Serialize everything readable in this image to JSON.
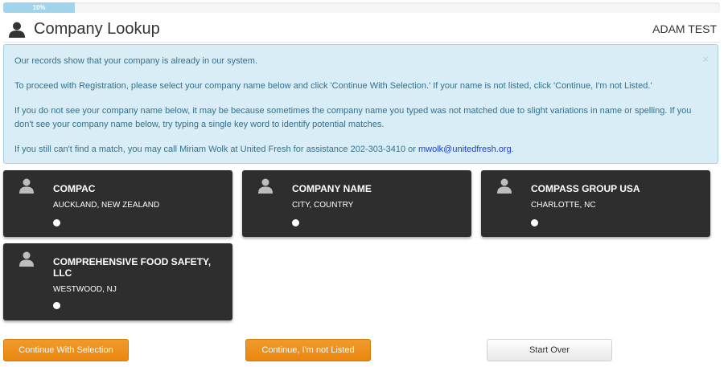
{
  "progress": {
    "value": 0.1,
    "label": "10%"
  },
  "header": {
    "title": "Company Lookup",
    "user": "ADAM TEST",
    "icon": "user-icon"
  },
  "alert": {
    "line1": "Our records show that your company is already in our system.",
    "line2": "To proceed with Registration, please select your company name below and click 'Continue With Selection.' If your name is not listed, click 'Continue, I'm not Listed.'",
    "line3": "If you do not see your company name below, it may be because sometimes the company name you typed was not matched due to slight variations in name or spelling. If you don't see your company name below, try typing a single key word to identify potential matches.",
    "line4_prefix": "If you still can't find a match, you may call Miriam Wolk at United Fresh for assistance 202-303-3410 or ",
    "email": "mwolk@unitedfresh.org",
    "line4_suffix": ".",
    "close": "×"
  },
  "companies": [
    {
      "name": "COMPAC",
      "location": "AUCKLAND, NEW ZEALAND"
    },
    {
      "name": "COMPANY NAME",
      "location": "CITY, COUNTRY"
    },
    {
      "name": "COMPASS GROUP USA",
      "location": "CHARLOTTE, NC"
    },
    {
      "name": "COMPREHENSIVE FOOD SAFETY, LLC",
      "location": "WESTWOOD, NJ"
    }
  ],
  "buttons": {
    "continue_selection": "Continue With Selection",
    "continue_not_listed": "Continue, I'm not Listed",
    "start_over": "Start Over"
  },
  "colors": {
    "accent_orange": "#ee921f",
    "card_bg": "#2e2e2e",
    "alert_bg": "#d9edf7",
    "progress": "#9fd4ec"
  }
}
